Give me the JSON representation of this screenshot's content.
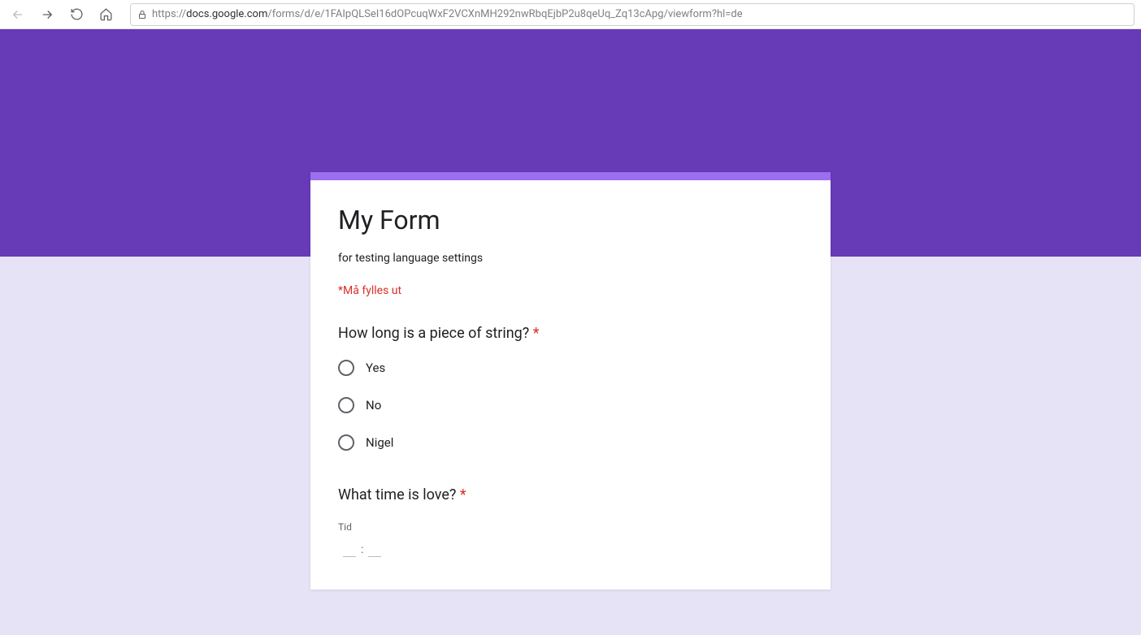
{
  "browser": {
    "url_prefix": "https://",
    "url_domain": "docs.google.com",
    "url_path": "/forms/d/e/1FAIpQLSeI16dOPcuqWxF2VCXnMH292nwRbqEjbP2u8qeUq_Zq13cApg/viewform?hl=de"
  },
  "form": {
    "title": "My Form",
    "description": "for testing language settings",
    "required_note": "*Må fylles ut",
    "questions": [
      {
        "label": "How long is a piece of string?",
        "required": true,
        "options": [
          "Yes",
          "No",
          "Nigel"
        ]
      },
      {
        "label": "What time is love?",
        "required": true,
        "time_label": "Tid",
        "separator": ":"
      }
    ]
  },
  "colors": {
    "banner": "#673ab7",
    "accent": "#9b6ff0",
    "page": "#e7e3f6",
    "error": "#d93025"
  }
}
